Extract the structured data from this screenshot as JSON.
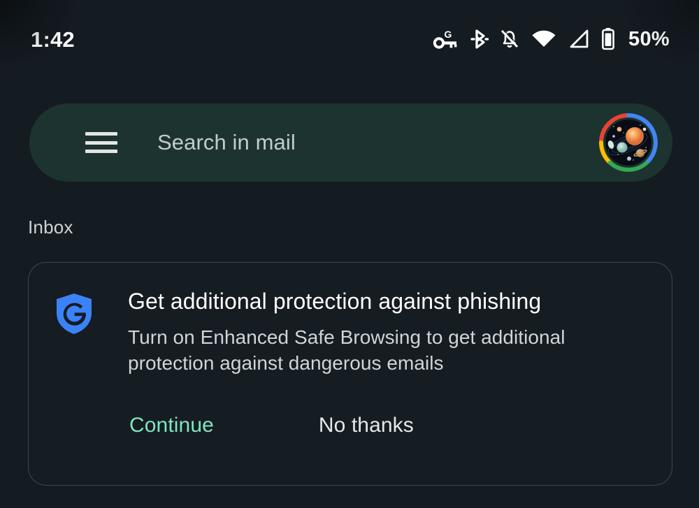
{
  "status_bar": {
    "clock": "1:42",
    "battery_percent": "50%",
    "icons": [
      {
        "name": "vpn-key-google-icon",
        "label": "VPN key with G"
      },
      {
        "name": "bluetooth-icon",
        "label": "Bluetooth"
      },
      {
        "name": "notifications-muted-icon",
        "label": "Notifications silenced"
      },
      {
        "name": "wifi-icon",
        "label": "Wi-Fi full"
      },
      {
        "name": "cell-signal-icon",
        "label": "Mobile signal"
      },
      {
        "name": "battery-icon",
        "label": "Battery"
      }
    ]
  },
  "search": {
    "placeholder": "Search in mail",
    "menu_icon": "hamburger-menu-icon",
    "background_color": "#1d3330"
  },
  "account": {
    "avatar_icon": "account-avatar",
    "ring_colors": [
      "#ea4335",
      "#fbbc04",
      "#34a853",
      "#4285f4"
    ]
  },
  "mailbox": {
    "label": "Inbox"
  },
  "promo_card": {
    "icon": "google-safe-browsing-shield-icon",
    "icon_color": "#3b82f6",
    "title": "Get additional protection against phishing",
    "body": "Turn on Enhanced Safe Browsing to get additional protection against dangerous emails",
    "primary_action": "Continue",
    "secondary_action": "No thanks",
    "primary_action_color": "#7fe6bc"
  },
  "theme": {
    "background": "#141b21",
    "card_border": "#3b4a50",
    "text_primary": "#ffffff",
    "text_secondary": "#cfd5d8"
  }
}
